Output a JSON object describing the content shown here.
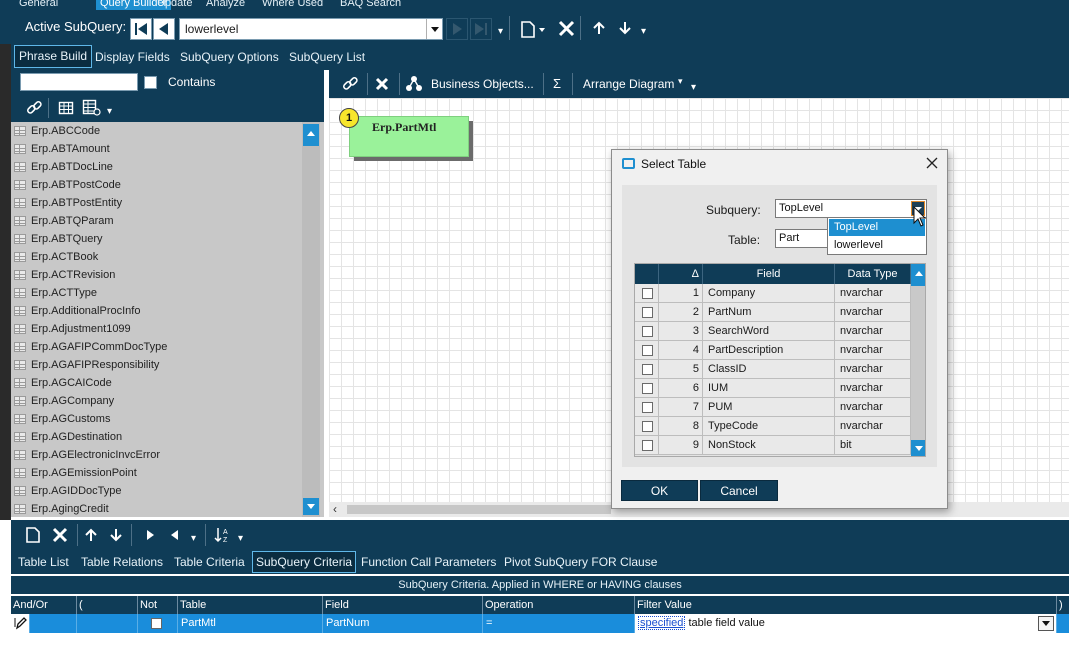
{
  "top_tabs": {
    "items": [
      "General",
      "Query Builder",
      "Update",
      "Analyze",
      "Where Used",
      "BAQ Search"
    ],
    "active_index": 1
  },
  "subquery_bar": {
    "label": "Active SubQuery:",
    "value": "lowerlevel"
  },
  "phrase_tabs": {
    "items": [
      "Phrase Build",
      "Display Fields",
      "SubQuery Options",
      "SubQuery List"
    ],
    "active_index": 0
  },
  "left_panel": {
    "search_value": "",
    "contains_label": "Contains",
    "tables": [
      "Erp.ABCCode",
      "Erp.ABTAmount",
      "Erp.ABTDocLine",
      "Erp.ABTPostCode",
      "Erp.ABTPostEntity",
      "Erp.ABTQParam",
      "Erp.ABTQuery",
      "Erp.ACTBook",
      "Erp.ACTRevision",
      "Erp.ACTType",
      "Erp.AdditionalProcInfo",
      "Erp.Adjustment1099",
      "Erp.AGAFIPCommDocType",
      "Erp.AGAFIPResponsibility",
      "Erp.AGCAICode",
      "Erp.AGCompany",
      "Erp.AGCustoms",
      "Erp.AGDestination",
      "Erp.AGElectronicInvcError",
      "Erp.AGEmissionPoint",
      "Erp.AGIDDocType",
      "Erp.AgingCredit"
    ]
  },
  "diagram_toolbar": {
    "business_objects": "Business Objects...",
    "sigma": "Σ",
    "arrange": "Arrange Diagram"
  },
  "diagram": {
    "node_number": "1",
    "node_label": "Erp.PartMtl"
  },
  "dialog": {
    "title": "Select Table",
    "subquery_label": "Subquery:",
    "subquery_value": "TopLevel",
    "subquery_options": [
      "TopLevel",
      "lowerlevel"
    ],
    "table_label": "Table:",
    "table_value": "Part",
    "grid_headers": {
      "sort": "Δ",
      "field": "Field",
      "type": "Data Type"
    },
    "rows": [
      {
        "num": "1",
        "field": "Company",
        "type": "nvarchar"
      },
      {
        "num": "2",
        "field": "PartNum",
        "type": "nvarchar"
      },
      {
        "num": "3",
        "field": "SearchWord",
        "type": "nvarchar"
      },
      {
        "num": "4",
        "field": "PartDescription",
        "type": "nvarchar"
      },
      {
        "num": "5",
        "field": "ClassID",
        "type": "nvarchar"
      },
      {
        "num": "6",
        "field": "IUM",
        "type": "nvarchar"
      },
      {
        "num": "7",
        "field": "PUM",
        "type": "nvarchar"
      },
      {
        "num": "8",
        "field": "TypeCode",
        "type": "nvarchar"
      },
      {
        "num": "9",
        "field": "NonStock",
        "type": "bit"
      }
    ],
    "ok_label": "OK",
    "cancel_label": "Cancel"
  },
  "bottom_tabs": {
    "items": [
      "Table List",
      "Table Relations",
      "Table Criteria",
      "SubQuery Criteria",
      "Function Call Parameters",
      "Pivot SubQuery FOR Clause"
    ],
    "active_index": 3
  },
  "criteria": {
    "title": "SubQuery Criteria. Applied in WHERE or HAVING clauses",
    "headers": [
      "And/Or",
      "(",
      "Not",
      "Table",
      "Field",
      "Operation",
      "Filter Value",
      ")"
    ],
    "row": {
      "and_or": "",
      "paren_open": "",
      "table": "PartMtl",
      "field": "PartNum",
      "operation": "=",
      "filter_link": "specified",
      "filter_rest": " table field value"
    }
  },
  "colors": {
    "dark_navy": "#0f3c57",
    "accent_blue": "#1a8ddb",
    "node_green": "#9af29a"
  }
}
